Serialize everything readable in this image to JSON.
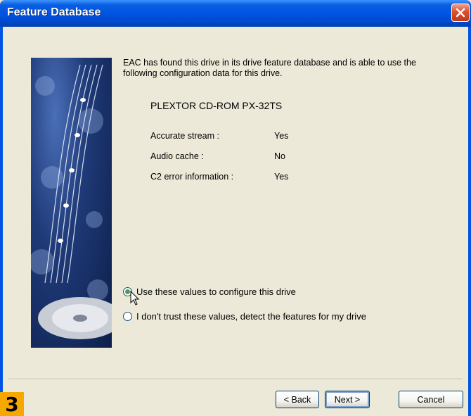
{
  "window": {
    "title": "Feature Database"
  },
  "content": {
    "intro": "EAC has found this drive in its drive feature database and is able to use the following configuration data for this drive.",
    "drive_name": "PLEXTOR CD-ROM PX-32TS",
    "features": [
      {
        "label": "Accurate stream :",
        "value": "Yes"
      },
      {
        "label": "Audio cache :",
        "value": "No"
      },
      {
        "label": "C2 error information :",
        "value": "Yes"
      }
    ]
  },
  "options": [
    {
      "label": "Use these values to configure this drive",
      "checked": true
    },
    {
      "label": "I don't trust these values, detect the features for my drive",
      "checked": false
    }
  ],
  "buttons": {
    "back": "< Back",
    "next": "Next >",
    "cancel": "Cancel"
  },
  "badge": "3",
  "colors": {
    "titlebar": "#0054e3",
    "dialog_bg": "#ece9d8",
    "badge": "#f5a800"
  }
}
